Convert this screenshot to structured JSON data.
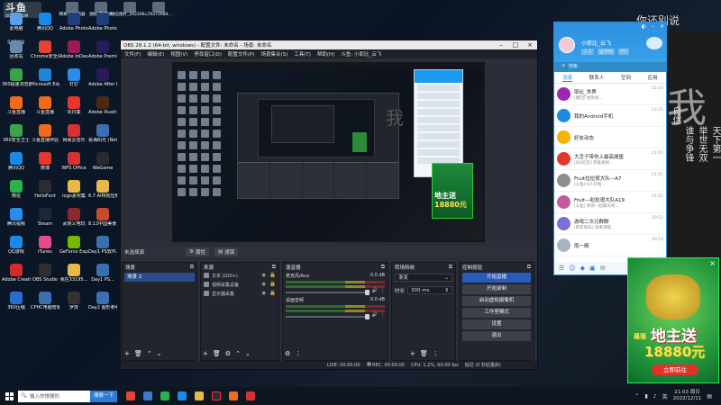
{
  "watermark": {
    "brand": "斗鱼",
    "site": "DOUYU.COM",
    "room": "58599"
  },
  "desktop_icons": [
    {
      "label": "此电脑",
      "icon": "computer-icon",
      "color": "#5aa0e8"
    },
    {
      "label": "腾讯QQ",
      "icon": "qq-icon",
      "color": "#1a8ae6"
    },
    {
      "label": "Adobe Photosh...",
      "icon": "photoshop-icon",
      "color": "#1f3f7a"
    },
    {
      "label": "Adobe Photosh...",
      "icon": "photoshop-icon",
      "color": "#1f3f7a"
    },
    {
      "label": "回收站",
      "icon": "recycle-bin-icon",
      "color": "#6c8aa8"
    },
    {
      "label": "Chrome安全浏览器",
      "icon": "chrome-icon",
      "color": "#e94235"
    },
    {
      "label": "Adobe InDesi...",
      "icon": "indesign-icon",
      "color": "#9c1b55"
    },
    {
      "label": "Adobe Premie...",
      "icon": "premiere-icon",
      "color": "#2a1a5a"
    },
    {
      "label": "360极速浏览器",
      "icon": "360-browser-icon",
      "color": "#3ba34a"
    },
    {
      "label": "Microsoft Edge",
      "icon": "edge-icon",
      "color": "#1f86d6"
    },
    {
      "label": "钉钉",
      "icon": "dingtalk-icon",
      "color": "#2a8ce8"
    },
    {
      "label": "Adobe After Effects 2020",
      "icon": "after-effects-icon",
      "color": "#2a1a5a"
    },
    {
      "label": "斗鱼直播",
      "icon": "douyu-icon",
      "color": "#f26b1d"
    },
    {
      "label": "斗鱼直播",
      "icon": "douyu-icon",
      "color": "#f26b1d"
    },
    {
      "label": "向日葵",
      "icon": "sunflower-icon",
      "color": "#e6372d"
    },
    {
      "label": "Adobe Illustrat...",
      "icon": "illustrator-icon",
      "color": "#4a2a10"
    },
    {
      "label": "360安全卫士",
      "icon": "360-safe-icon",
      "color": "#3ba34a"
    },
    {
      "label": "斗鱼直播伴侣",
      "icon": "douyu-companion-icon",
      "color": "#f26b1d"
    },
    {
      "label": "网易云音乐",
      "icon": "netease-music-icon",
      "color": "#d63232"
    },
    {
      "label": "看海阳光 (Netkyring)...",
      "icon": "app-icon",
      "color": "#3b6fb0"
    },
    {
      "label": "腾讯QQ",
      "icon": "qq-icon",
      "color": "#1a8ae6"
    },
    {
      "label": "微博",
      "icon": "weibo-icon",
      "color": "#e6372d"
    },
    {
      "label": "WPS Office",
      "icon": "wps-icon",
      "color": "#d63232"
    },
    {
      "label": "WeGame",
      "icon": "wegame-icon",
      "color": "#2a2a2a"
    },
    {
      "label": "微信",
      "icon": "wechat-icon",
      "color": "#2bb24c"
    },
    {
      "label": "HelloFont",
      "icon": "hellofont-icon",
      "color": "#2c2c2c"
    },
    {
      "label": "logo素材集",
      "icon": "folder-icon",
      "color": "#e8b84a"
    },
    {
      "label": "6.7 Ai特效应用",
      "icon": "folder-icon",
      "color": "#e8b84a"
    },
    {
      "label": "腾讯视频",
      "icon": "tencent-video-icon",
      "color": "#2a8ce8"
    },
    {
      "label": "Steam",
      "icon": "steam-icon",
      "color": "#1b2838"
    },
    {
      "label": "武侠乂电玩",
      "icon": "game-icon",
      "color": "#8a2a2a"
    },
    {
      "label": "8.12中国美食大赛海报",
      "icon": "image-icon",
      "color": "#c84a2a"
    },
    {
      "label": "QQ游戏",
      "icon": "qq-game-icon",
      "color": "#1a8ae6"
    },
    {
      "label": "iTunes",
      "icon": "itunes-icon",
      "color": "#e84a8a"
    },
    {
      "label": "GeForce Experience",
      "icon": "geforce-icon",
      "color": "#76b900"
    },
    {
      "label": "Day1 PS软件...",
      "icon": "image-icon",
      "color": "#3b6fb0"
    },
    {
      "label": "Adobe Creati...",
      "icon": "creative-cloud-icon",
      "color": "#d62a2a"
    },
    {
      "label": "OBS Studio",
      "icon": "obs-icon",
      "color": "#302e31"
    },
    {
      "label": "我在33195...",
      "icon": "folder-icon",
      "color": "#e8b84a"
    },
    {
      "label": "Day1 PS...",
      "icon": "image-icon",
      "color": "#3b6fb0"
    },
    {
      "label": "360压缩",
      "icon": "360-zip-icon",
      "color": "#2a6bd0"
    },
    {
      "label": "CPHC电脑管家",
      "icon": "app-icon",
      "color": "#3b6fb0"
    },
    {
      "label": "罗技",
      "icon": "logitech-icon",
      "color": "#333"
    },
    {
      "label": "Day2 图形参考...",
      "icon": "image-icon",
      "color": "#3b6fb0"
    }
  ],
  "top_thumbs": [
    {
      "label": "网易UU加速器"
    },
    {
      "label": "图标·零·整体"
    },
    {
      "label": "微信图片_202206..."
    },
    {
      "label": "c70a72684..."
    }
  ],
  "bg_text": {
    "top": "你还别说",
    "big": "我",
    "col1": "天下第一",
    "col2": "举世无双",
    "col3": "谁与争锋",
    "col4": "自信"
  },
  "obs": {
    "title": "OBS 28.1.2 (64-bit, windows) - 配置文件: 未命名 - 场景: 未命名",
    "menu": [
      "文件(F)",
      "编辑(E)",
      "视图(V)",
      "停靠窗口(D)",
      "配置文件(P)",
      "场景集合(S)",
      "工具(T)",
      "帮助(H)",
      "斗鱼: 小耶比_云飞"
    ],
    "status": {
      "scene_label": "未选择源",
      "props": "属性",
      "filters": "滤镜"
    },
    "docks": {
      "scenes": {
        "title": "场景",
        "items": [
          "场景 2"
        ]
      },
      "sources": {
        "title": "来源",
        "items": [
          "文本 (GDI+)",
          "视频采集设备",
          "显示器采集"
        ]
      },
      "mixer": {
        "title": "混音器",
        "rows": [
          {
            "name": "麦克风/Aux",
            "db": "0.0 dB"
          },
          {
            "name": "桌面音频",
            "db": "0.0 dB"
          }
        ]
      },
      "transitions": {
        "title": "转场特效",
        "type": "渐变",
        "duration_label": "时长",
        "duration": "300 ms"
      },
      "controls": {
        "title": "控制按钮",
        "buttons": [
          "开始直播",
          "开始录制",
          "启动虚拟摄像机",
          "工作室模式",
          "设置",
          "退出"
        ]
      }
    },
    "bottom": {
      "live": "LIVE: 00:00:00",
      "rec": "REC: 00:00:00",
      "cpu": "CPU: 1.2%, 60.00 fps",
      "latency": "延迟 (0 秒后重启)"
    }
  },
  "qq": {
    "nick": "小耶比_云飞",
    "status_tags": [
      "人人",
      "留学吧",
      "QQ"
    ],
    "search_placeholder": "搜索",
    "tabs": [
      "消息",
      "联系人",
      "空间",
      "应用"
    ],
    "items": [
      {
        "name": "耶比_世界",
        "msg": "[撤回] 给你发...",
        "time": "15:43",
        "color": "#9c27b0"
      },
      {
        "name": "我的Android手机",
        "msg": "",
        "time": "13:35",
        "color": "#1a8ae6"
      },
      {
        "name": "好友动态",
        "msg": "",
        "time": "",
        "color": "#f5b400"
      },
      {
        "name": "大舌子带你上最高城堡",
        "msg": "[QQ红包] 恭喜发财...",
        "time": "21:01",
        "color": "#e6372d"
      },
      {
        "name": "Fruit拉拉很大队—A7",
        "msg": "[斗鱼] 6人在线...",
        "time": "21:01",
        "color": "#8e8e8e"
      },
      {
        "name": "Fruit—粒粒很大队A19",
        "msg": "[斗鱼] 和你一起聊天吧...",
        "time": "21:02",
        "color": "#c25b9a"
      },
      {
        "name": "游戏二次元群聊",
        "msg": "[新年快乐] 快来领取...",
        "time": "20:52",
        "color": "#7d6fd6"
      },
      {
        "name": "雨一晴",
        "msg": "",
        "time": "20:19",
        "color": "#a8b4c4"
      }
    ]
  },
  "ad": {
    "brand": "最强",
    "line1": "地主送",
    "line2": "18880元",
    "button": "立即前往"
  },
  "taskbar": {
    "search": "输入你想搜的",
    "search_btn": "搜索一下",
    "time": "21:03 周日",
    "date": "2022/12/11",
    "lang": "英"
  }
}
